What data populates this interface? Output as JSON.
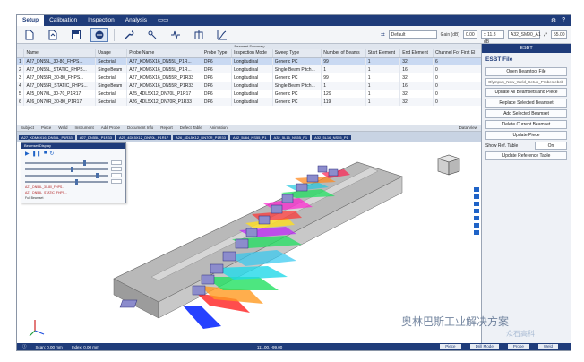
{
  "menu": {
    "items": [
      "Setup",
      "Calibration",
      "Inspection",
      "Analysis"
    ],
    "active": 0
  },
  "toolbar": {
    "filename": "Default",
    "gain_label": "Gain (dB)",
    "gain_value": "0.00",
    "gain_step": "± 11.8 dB",
    "probe_select": "A32_SM90_A1",
    "zoom": "55.00"
  },
  "table": {
    "caption": "Beamset Summary",
    "columns": [
      "Name",
      "Usage",
      "Probe Name",
      "Probe Type",
      "Inspection Mode",
      "Sweep Type",
      "Number of Beams",
      "Start Element",
      "End Element",
      "Channel For First El"
    ],
    "rows": [
      [
        "A27_DN55L_30-80_FHPS...",
        "Sectorial",
        "A27_KDM6X16_DN55L_P1R...",
        "DP6",
        "Longitudinal",
        "Generic PC",
        "99",
        "1",
        "32",
        "6"
      ],
      [
        "A27_DN55L_STATIC_FHPS...",
        "SingleBeam",
        "A27_KDM6X16_DN55L_P1R...",
        "DP6",
        "Longitudinal",
        "Single Beam Pitch...",
        "1",
        "1",
        "16",
        "0"
      ],
      [
        "A27_DN55R_30-80_FHPS...",
        "Sectorial",
        "A27_KDM6X16_DN55R_P1R33",
        "DP6",
        "Longitudinal",
        "Generic PC",
        "99",
        "1",
        "32",
        "0"
      ],
      [
        "A27_DN55R_STATIC_FHPS...",
        "SingleBeam",
        "A27_KDM6X16_DN55R_P1R33",
        "DP6",
        "Longitudinal",
        "Single Beam Pitch...",
        "1",
        "1",
        "16",
        "0"
      ],
      [
        "A25_DN70L_30-70_P1R17",
        "Sectorial",
        "A25_4DL5X12_DN70L_P1R17",
        "DP6",
        "Longitudinal",
        "Generic PC",
        "129",
        "1",
        "32",
        "0"
      ],
      [
        "A26_DN70R_30-80_P1R17",
        "Sectorial",
        "A26_4DL5X12_DN70R_P1R33",
        "DP6",
        "Longitudinal",
        "Generic PC",
        "119",
        "1",
        "32",
        "0"
      ]
    ]
  },
  "subbar": [
    "Subject",
    "Piece",
    "Weld",
    "Instrument",
    "Add Probe",
    "Document Info",
    "Report",
    "Defect Table",
    "Animation"
  ],
  "probebar": [
    "A27_KDM6X16_DN55L_P1R33",
    "A27_DN55L_P1R33",
    "A25_4DL5X12_DN70L_P1R17",
    "A26_4DL5X12_DN70R_P1R33",
    "A32_5L64_NS55_P1",
    "A32_5L16_NS55_P1",
    "A32_5L16_NS55_P1"
  ],
  "dataview_label": "Data View",
  "dialog": {
    "title": "Beamset Display",
    "rows": [
      "A27_DN55L_30-80_FHPS...",
      "A27_DN55L_STATIC_FHPS..."
    ],
    "footer": "Full Beamset"
  },
  "panel": {
    "header": "ESBT",
    "title": "ESBT File",
    "buttons": [
      "Open Beamtool File",
      "Update All Beamsets and Piece",
      "Replace Selected Beamset",
      "Add Selected Beamset",
      "Delete Current Beamset",
      "Update Piece"
    ],
    "file_path": "Olympus_New_Weld_Setup_Probes.ebcb",
    "show_ref_label": "Show Ref. Table",
    "show_ref_value": "On",
    "update_ref": "Update Reference Table"
  },
  "status": {
    "scan": "Scan: 0.00 mm",
    "index": "Index: 0.00 mm",
    "coords": "111.00, -99.00",
    "buttons": [
      "Piece",
      "Drill Mode",
      "Probe",
      "Weld"
    ]
  },
  "watermark": "奥林巴斯工业解决方案",
  "watermark2": "众石高科"
}
